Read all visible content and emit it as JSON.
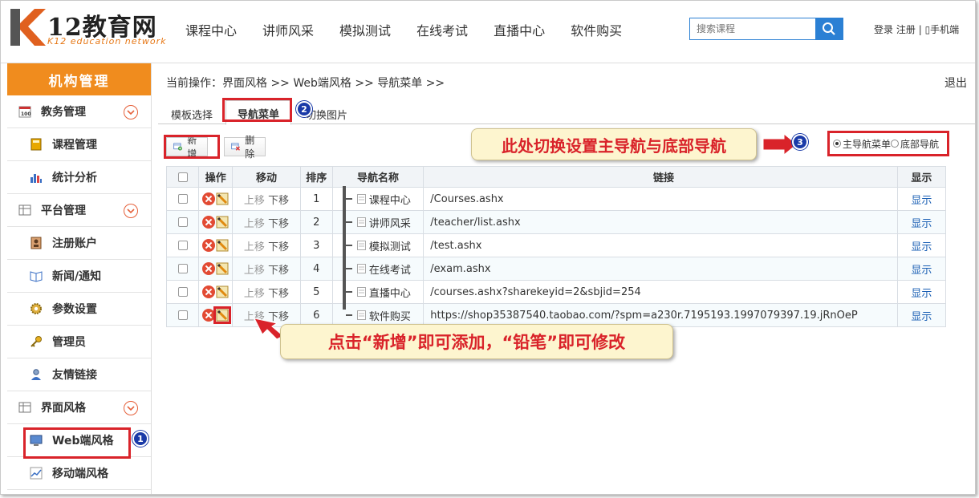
{
  "header": {
    "logo_text": "12教育网",
    "logo_sub": "K12 education network",
    "nav": [
      "课程中心",
      "讲师风采",
      "模拟测试",
      "在线考试",
      "直播中心",
      "软件购买"
    ],
    "search_placeholder": "搜索课程",
    "login": "登录",
    "register": "注册",
    "separator": "|",
    "mobile": "▯手机端"
  },
  "sidebar": {
    "title": "机构管理",
    "groups": [
      {
        "label": "教务管理",
        "icon": "calendar-icon"
      },
      {
        "label": "平台管理",
        "icon": "grid-icon"
      },
      {
        "label": "界面风格",
        "icon": "grid-icon"
      }
    ],
    "items": [
      {
        "label": "课程管理",
        "icon": "book-icon"
      },
      {
        "label": "统计分析",
        "icon": "bar-chart-icon"
      },
      {
        "label": "注册账户",
        "icon": "id-card-icon"
      },
      {
        "label": "新闻/通知",
        "icon": "open-book-icon"
      },
      {
        "label": "参数设置",
        "icon": "gear-icon"
      },
      {
        "label": "管理员",
        "icon": "key-icon"
      },
      {
        "label": "友情链接",
        "icon": "user-icon"
      },
      {
        "label": "Web端风格",
        "icon": "monitor-icon"
      },
      {
        "label": "移动端风格",
        "icon": "line-chart-icon"
      }
    ]
  },
  "main": {
    "breadcrumb": "当前操作：界面风格 >> Web端风格 >> 导航菜单 >>",
    "logout": "退出",
    "tabs": [
      "模板选择",
      "导航菜单",
      "切换图片"
    ],
    "toolbar": {
      "add": "新增",
      "delete": "删除"
    },
    "radio": {
      "main": "主导航菜单",
      "footer": "底部导航",
      "selected": "main"
    },
    "callout_top": "此处切换设置主导航与底部导航",
    "callout_bottom": "点击“新增”即可添加，“铅笔”即可修改",
    "badges": [
      "1",
      "2",
      "3"
    ],
    "table": {
      "headers": [
        "操作",
        "移动",
        "排序",
        "导航名称",
        "链接",
        "显示"
      ],
      "up_label": "上移",
      "down_label": "下移",
      "rows": [
        {
          "order": "1",
          "name": "课程中心",
          "link": "/Courses.ashx",
          "show": "显示"
        },
        {
          "order": "2",
          "name": "讲师风采",
          "link": "/teacher/list.ashx",
          "show": "显示"
        },
        {
          "order": "3",
          "name": "模拟测试",
          "link": "/test.ashx",
          "show": "显示"
        },
        {
          "order": "4",
          "name": "在线考试",
          "link": "/exam.ashx",
          "show": "显示"
        },
        {
          "order": "5",
          "name": "直播中心",
          "link": "/courses.ashx?sharekeyid=2&sbjid=254",
          "show": "显示"
        },
        {
          "order": "6",
          "name": "软件购买",
          "link": "https://shop35387540.taobao.com/?spm=a230r.7195193.1997079397.19.jRnOeP",
          "show": "显示"
        }
      ]
    }
  },
  "colors": {
    "accent": "#f08c1e",
    "highlight": "#d9232a",
    "search": "#2b80d4",
    "badge": "#1a3aa8"
  }
}
